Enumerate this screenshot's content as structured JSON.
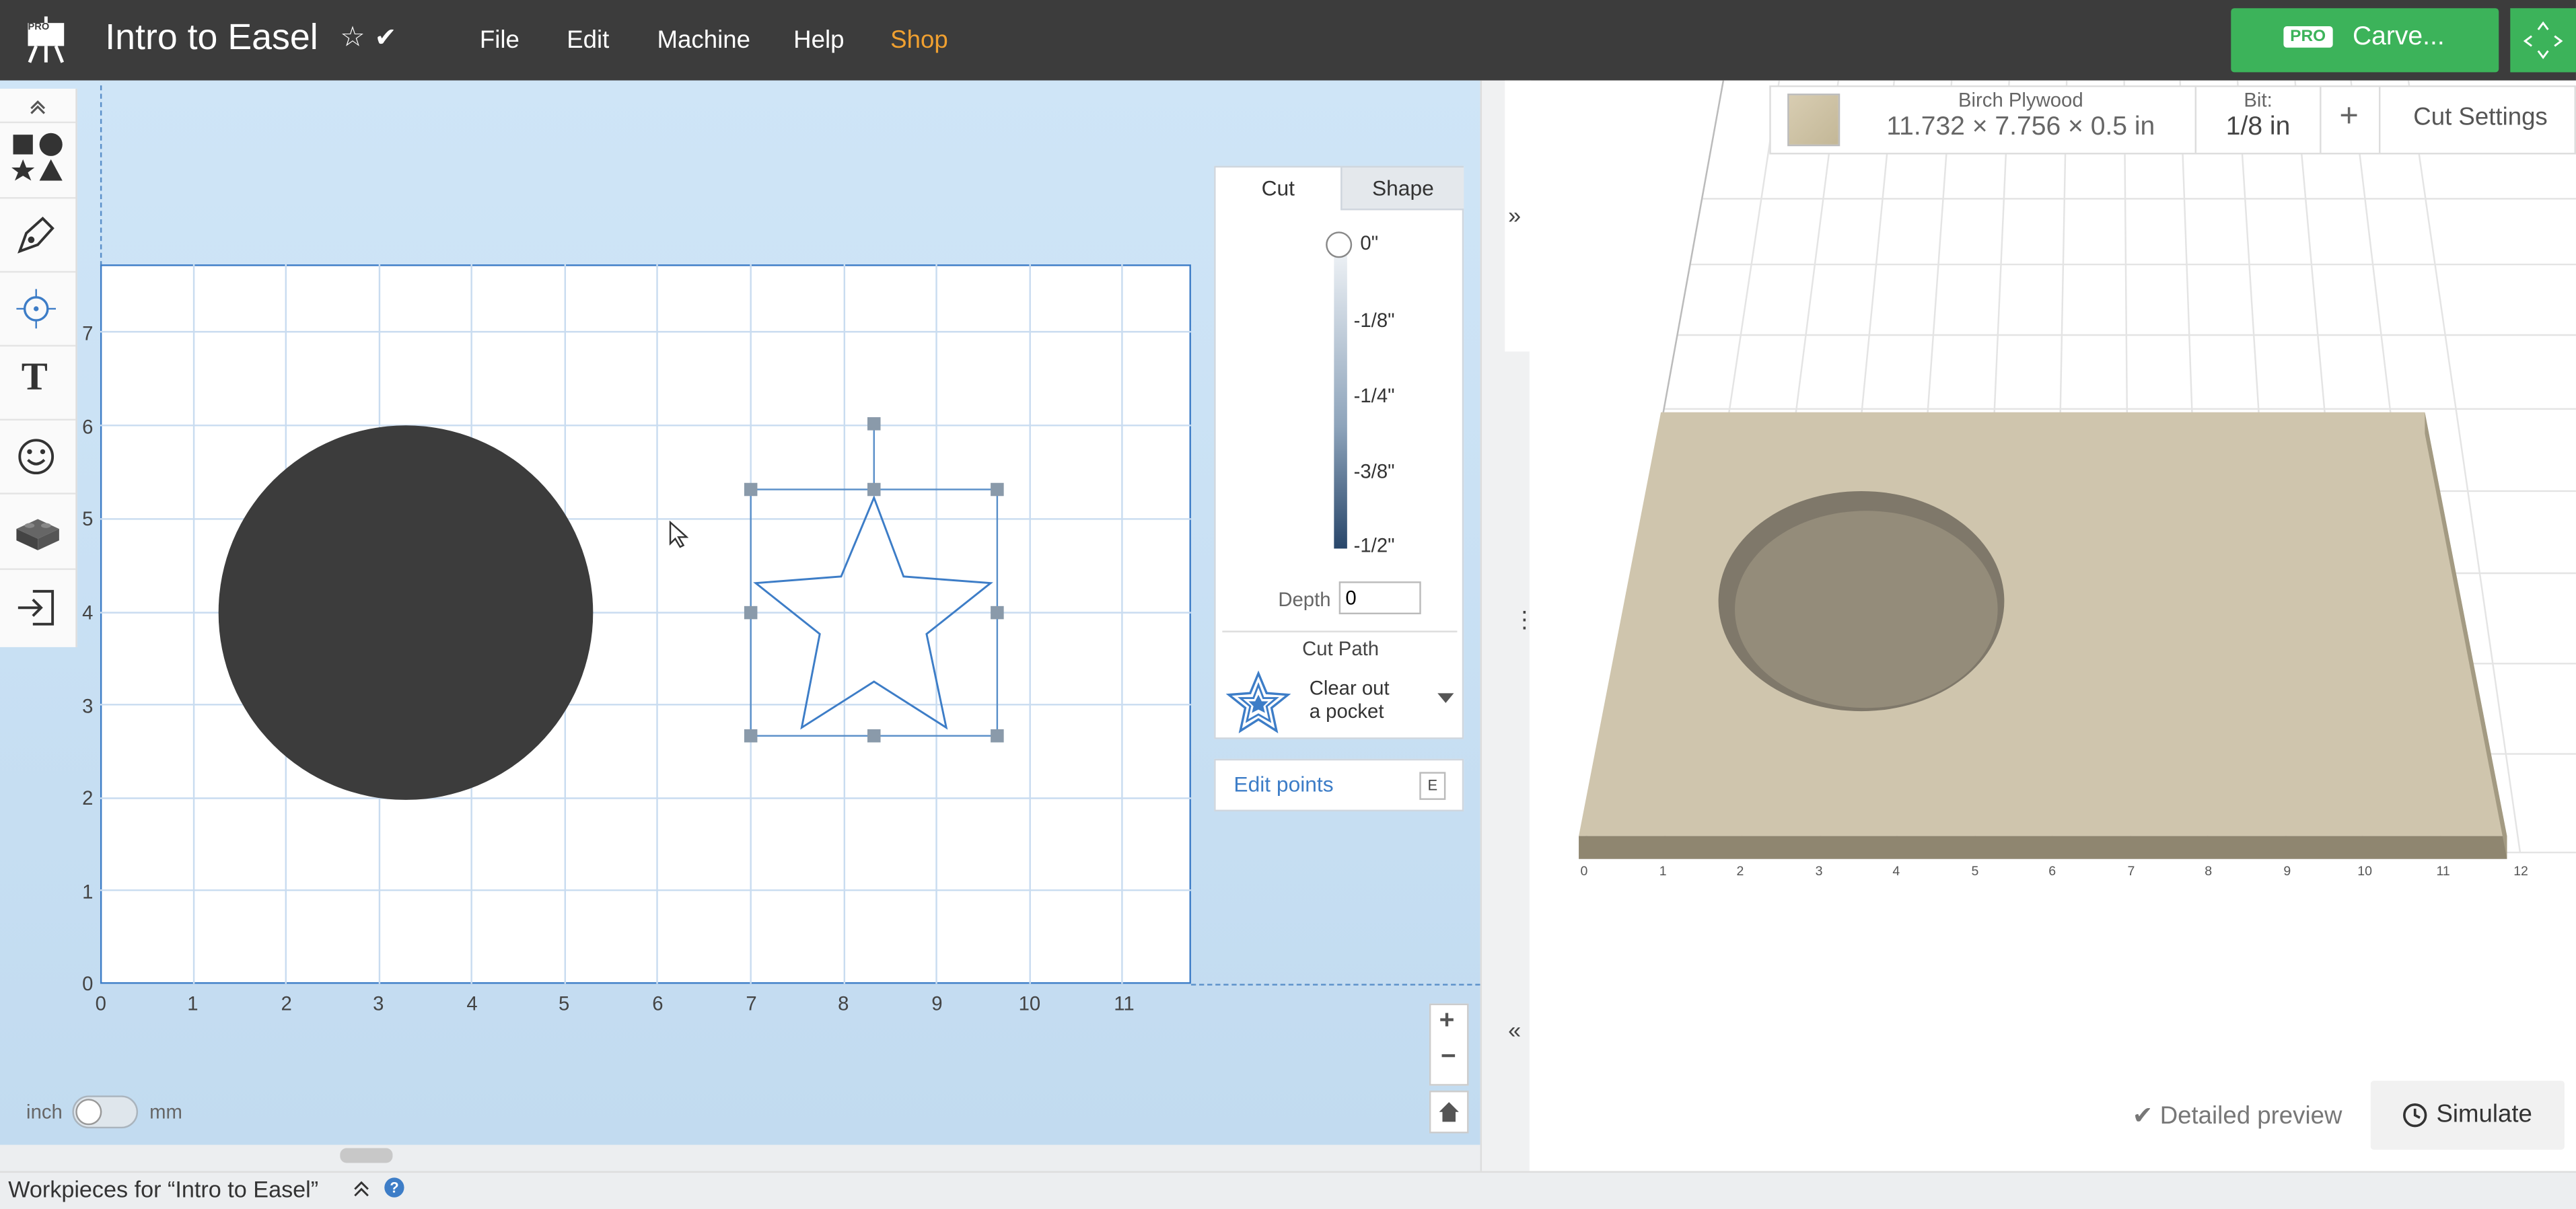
{
  "app": {
    "title": "Intro to Easel",
    "logo_badge": "PRO",
    "menu": [
      "File",
      "Edit",
      "Machine",
      "Help",
      "Shop"
    ],
    "accent_color": "#f0a030",
    "carve": {
      "badge": "PRO",
      "label": "Carve..."
    }
  },
  "canvas": {
    "y_ticks": [
      "7",
      "6",
      "5",
      "4",
      "3",
      "2",
      "1",
      "0"
    ],
    "x_ticks": [
      "0",
      "1",
      "2",
      "3",
      "4",
      "5",
      "6",
      "7",
      "8",
      "9",
      "10",
      "11"
    ],
    "units": {
      "left": "inch",
      "right": "mm",
      "selected": "inch"
    }
  },
  "cut_panel": {
    "tabs": [
      "Cut",
      "Shape"
    ],
    "active_tab": "Cut",
    "depth_marks": [
      "0\"",
      "-1/8\"",
      "-1/4\"",
      "-3/8\"",
      "-1/2\""
    ],
    "depth_label": "Depth",
    "depth_value": "0",
    "cut_path_label": "Cut Path",
    "cut_path_value_line1": "Clear out",
    "cut_path_value_line2": "a pocket",
    "edit_points_label": "Edit points",
    "edit_points_key": "E"
  },
  "preview": {
    "material_name": "Birch Plywood",
    "material_dims": "11.732 × 7.756 × 0.5 in",
    "bit_label": "Bit:",
    "bit_value": "1/8 in",
    "add": "+",
    "cut_settings": "Cut Settings",
    "x_ticks": [
      "0",
      "1",
      "2",
      "3",
      "4",
      "5",
      "6",
      "7",
      "8",
      "9",
      "10",
      "11",
      "12"
    ],
    "detailed_preview": "Detailed preview",
    "simulate": "Simulate"
  },
  "footer": {
    "workpieces": "Workpieces for “Intro to Easel”",
    "help": "?"
  },
  "icons": [
    "easel-logo-icon",
    "star-icon",
    "check-icon",
    "shapes-icon",
    "pen-icon",
    "target-icon",
    "text-icon",
    "emoji-icon",
    "lego-icon",
    "import-icon",
    "plus-icon",
    "minus-icon",
    "home-icon",
    "clock-icon",
    "chevron-right-icon",
    "chevron-left-icon"
  ]
}
